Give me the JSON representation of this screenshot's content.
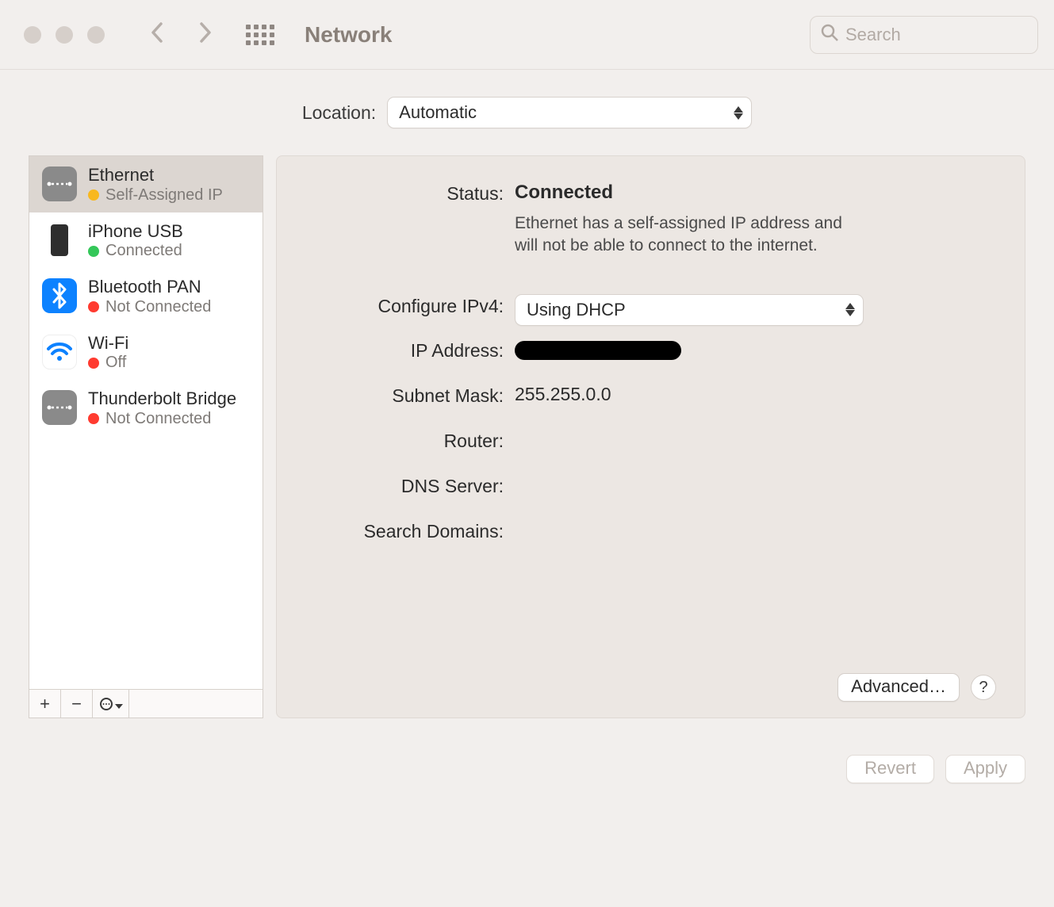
{
  "toolbar": {
    "title": "Network",
    "search_placeholder": "Search"
  },
  "location": {
    "label": "Location:",
    "value": "Automatic"
  },
  "sidebar": {
    "items": [
      {
        "name": "Ethernet",
        "status": "Self-Assigned IP",
        "dot": "yellow"
      },
      {
        "name": "iPhone USB",
        "status": "Connected",
        "dot": "green"
      },
      {
        "name": "Bluetooth PAN",
        "status": "Not Connected",
        "dot": "red"
      },
      {
        "name": "Wi-Fi",
        "status": "Off",
        "dot": "red"
      },
      {
        "name": "Thunderbolt Bridge",
        "status": "Not Connected",
        "dot": "red"
      }
    ],
    "footer": {
      "add": "+",
      "remove": "−"
    }
  },
  "detail": {
    "status_label": "Status:",
    "status_value": "Connected",
    "status_desc": "Ethernet has a self-assigned IP address and will not be able to connect to the internet.",
    "configure_label": "Configure IPv4:",
    "configure_value": "Using DHCP",
    "ip_label": "IP Address:",
    "subnet_label": "Subnet Mask:",
    "subnet_value": "255.255.0.0",
    "router_label": "Router:",
    "dns_label": "DNS Server:",
    "search_domains_label": "Search Domains:",
    "advanced": "Advanced…",
    "help": "?"
  },
  "bottom": {
    "revert": "Revert",
    "apply": "Apply"
  }
}
